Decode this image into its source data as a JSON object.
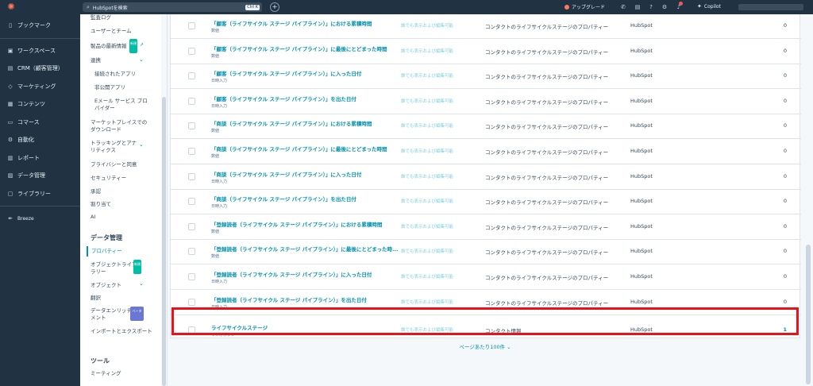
{
  "topbar": {
    "search_placeholder": "HubSpotを検索",
    "search_shortcut": "Ctrl K",
    "upgrade_label": "アップグレード",
    "copilot_label": "Copilot"
  },
  "leftnav": {
    "items": [
      {
        "icon": "bookmark-icon",
        "glyph": "▯",
        "label": "ブックマーク"
      },
      {
        "icon": "workspace-icon",
        "glyph": "▣",
        "label": "ワークスペース"
      },
      {
        "icon": "crm-icon",
        "glyph": "▤",
        "label": "CRM（顧客管理）"
      },
      {
        "icon": "marketing-icon",
        "glyph": "◇",
        "label": "マーケティング"
      },
      {
        "icon": "content-icon",
        "glyph": "▦",
        "label": "コンテンツ"
      },
      {
        "icon": "commerce-icon",
        "glyph": "▭",
        "label": "コマース"
      },
      {
        "icon": "automation-icon",
        "glyph": "⚙",
        "label": "自動化"
      },
      {
        "icon": "reports-icon",
        "glyph": "▥",
        "label": "レポート"
      },
      {
        "icon": "data-management-icon",
        "glyph": "▨",
        "label": "データ管理"
      },
      {
        "icon": "library-icon",
        "glyph": "▢",
        "label": "ライブラリー"
      }
    ],
    "breeze_label": "Breeze"
  },
  "settings": {
    "items_top": [
      {
        "label": "監査ログ",
        "top": 0
      },
      {
        "label": "ユーザーとチーム",
        "top": 0
      }
    ],
    "latest_label": "製品の最新情報",
    "new_tag": "新規",
    "integrations_label": "連携",
    "integrations_sub": [
      "接続されたアプリ",
      "非公開アプリ",
      "Eメール サービス プロ",
      "バイダー"
    ],
    "marketplace_line1": "マーケットプレイスでの",
    "marketplace_line2": "ダウンロード",
    "tracking_line1": "トラッキングとアナ",
    "tracking_line2": "リティクス",
    "privacy_label": "プライバシーと同意",
    "security_label": "セキュリティー",
    "approval_label": "承認",
    "assign_label": "割り当て",
    "ai_label": "AI",
    "data_header": "データ管理",
    "properties_label": "プロパティー",
    "objlib_line1": "オブジェクトライブ",
    "objlib_line2": "ラリー",
    "objects_label": "オブジェクト",
    "translation_label": "翻訳",
    "enrich_line1": "データエンリッチ",
    "enrich_line2": "メント",
    "beta_tag": "ベータ",
    "import_label": "インポートとエクスポート",
    "tools_header": "ツール",
    "meeting_label": "ミーティング"
  },
  "table": {
    "rows": [
      {
        "name": "「顧客（ライフサイクル ステージ パイプライン）」における累積時間",
        "type": "数値",
        "visibility": "誰でも表示および編集可能",
        "group": "コンタクトのライフサイクルステージのプロパティー",
        "owner": "HubSpot",
        "used": "0"
      },
      {
        "name": "「顧客（ライフサイクル ステージ パイプライン）」に最後にとどまった時間",
        "type": "数値",
        "visibility": "誰でも表示および編集可能",
        "group": "コンタクトのライフサイクルステージのプロパティー",
        "owner": "HubSpot",
        "used": "0"
      },
      {
        "name": "「顧客（ライフサイクル ステージ パイプライン）」に入った日付",
        "type": "日時入力",
        "visibility": "誰でも表示および編集可能",
        "group": "コンタクトのライフサイクルステージのプロパティー",
        "owner": "HubSpot",
        "used": "0"
      },
      {
        "name": "「顧客（ライフサイクル ステージ パイプライン）」を出た日付",
        "type": "日時入力",
        "visibility": "誰でも表示および編集可能",
        "group": "コンタクトのライフサイクルステージのプロパティー",
        "owner": "HubSpot",
        "used": "0"
      },
      {
        "name": "「商談（ライフサイクル ステージ パイプライン）」における累積時間",
        "type": "数値",
        "visibility": "誰でも表示および編集可能",
        "group": "コンタクトのライフサイクルステージのプロパティー",
        "owner": "HubSpot",
        "used": "0"
      },
      {
        "name": "「商談（ライフサイクル ステージ パイプライン）」に最後にとどまった時間",
        "type": "数値",
        "visibility": "誰でも表示および編集可能",
        "group": "コンタクトのライフサイクルステージのプロパティー",
        "owner": "HubSpot",
        "used": "0"
      },
      {
        "name": "「商談（ライフサイクル ステージ パイプライン）」に入った日付",
        "type": "日時入力",
        "visibility": "誰でも表示および編集可能",
        "group": "コンタクトのライフサイクルステージのプロパティー",
        "owner": "HubSpot",
        "used": "0"
      },
      {
        "name": "「商談（ライフサイクル ステージ パイプライン）」を出た日付",
        "type": "日時入力",
        "visibility": "誰でも表示および編集可能",
        "group": "コンタクトのライフサイクルステージのプロパティー",
        "owner": "HubSpot",
        "used": "0"
      },
      {
        "name": "「登録読者（ライフサイクル ステージ パイプライン）」における累積時間",
        "type": "数値",
        "visibility": "誰でも表示および編集可能",
        "group": "コンタクトのライフサイクルステージのプロパティー",
        "owner": "HubSpot",
        "used": "0"
      },
      {
        "name": "「登録読者（ライフサイクル ステージ パイプライン）」に最後にとどまった時...",
        "type": "数値",
        "visibility": "誰でも表示および編集可能",
        "group": "コンタクトのライフサイクルステージのプロパティー",
        "owner": "HubSpot",
        "used": "0"
      },
      {
        "name": "「登録読者（ライフサイクル ステージ パイプライン）」に入った日付",
        "type": "日時入力",
        "visibility": "誰でも表示および編集可能",
        "group": "コンタクトのライフサイクルステージのプロパティー",
        "owner": "HubSpot",
        "used": "0"
      },
      {
        "name": "「登録読者（ライフサイクル ステージ パイプライン）」を出た日付",
        "type": "日時入力",
        "visibility": "誰でも表示および編集可能",
        "group": "コンタクトのライフサイクルステージのプロパティー",
        "owner": "HubSpot",
        "used": "0"
      },
      {
        "name": "ライフサイクルステージ",
        "type": "ラジオボタン",
        "visibility": "誰でも表示および編集可能",
        "group": "コンタクト情報",
        "owner": "HubSpot",
        "used": "1"
      }
    ],
    "pager_label": "ページあたり100件 ⌄"
  }
}
